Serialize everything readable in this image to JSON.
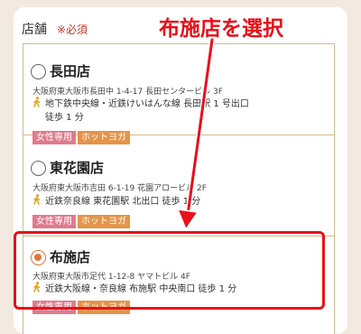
{
  "form": {
    "label": "店舗",
    "required": "※必須"
  },
  "stores": [
    {
      "name": "長田店",
      "address": "大阪府東大阪市長田中 1-4-17 長田センタービル 3F",
      "access_line1": "地下鉄中央線・近鉄けいはんな線 長田駅 1 号出口",
      "access_line2": "徒歩 1 分",
      "tags": [
        "女性専用",
        "ホットヨガ"
      ],
      "selected": false
    },
    {
      "name": "東花園店",
      "address": "大阪府東大阪市吉田 6-1-19 花園アロービル 2F",
      "access_line1": "近鉄奈良線 東花園駅 北出口 徒歩 1 分",
      "tags": [
        "女性専用",
        "ホットヨガ"
      ],
      "selected": false
    },
    {
      "name": "布施店",
      "address": "大阪府東大阪市足代 1-12-8 ヤマトビル 4F",
      "access_line1": "近鉄大阪線・奈良線 布施駅 中央南口 徒歩 1 分",
      "tags": [
        "女性専用",
        "ホットヨガ"
      ],
      "selected": true
    }
  ],
  "annotation": {
    "callout": "布施店を選択",
    "color": "#e8101a"
  },
  "colors": {
    "accent": "#e2763a",
    "tag_pink": "#e07b8c",
    "tag_orange": "#e5944a",
    "border": "#d7b98a",
    "background": "#f3e9e1"
  }
}
